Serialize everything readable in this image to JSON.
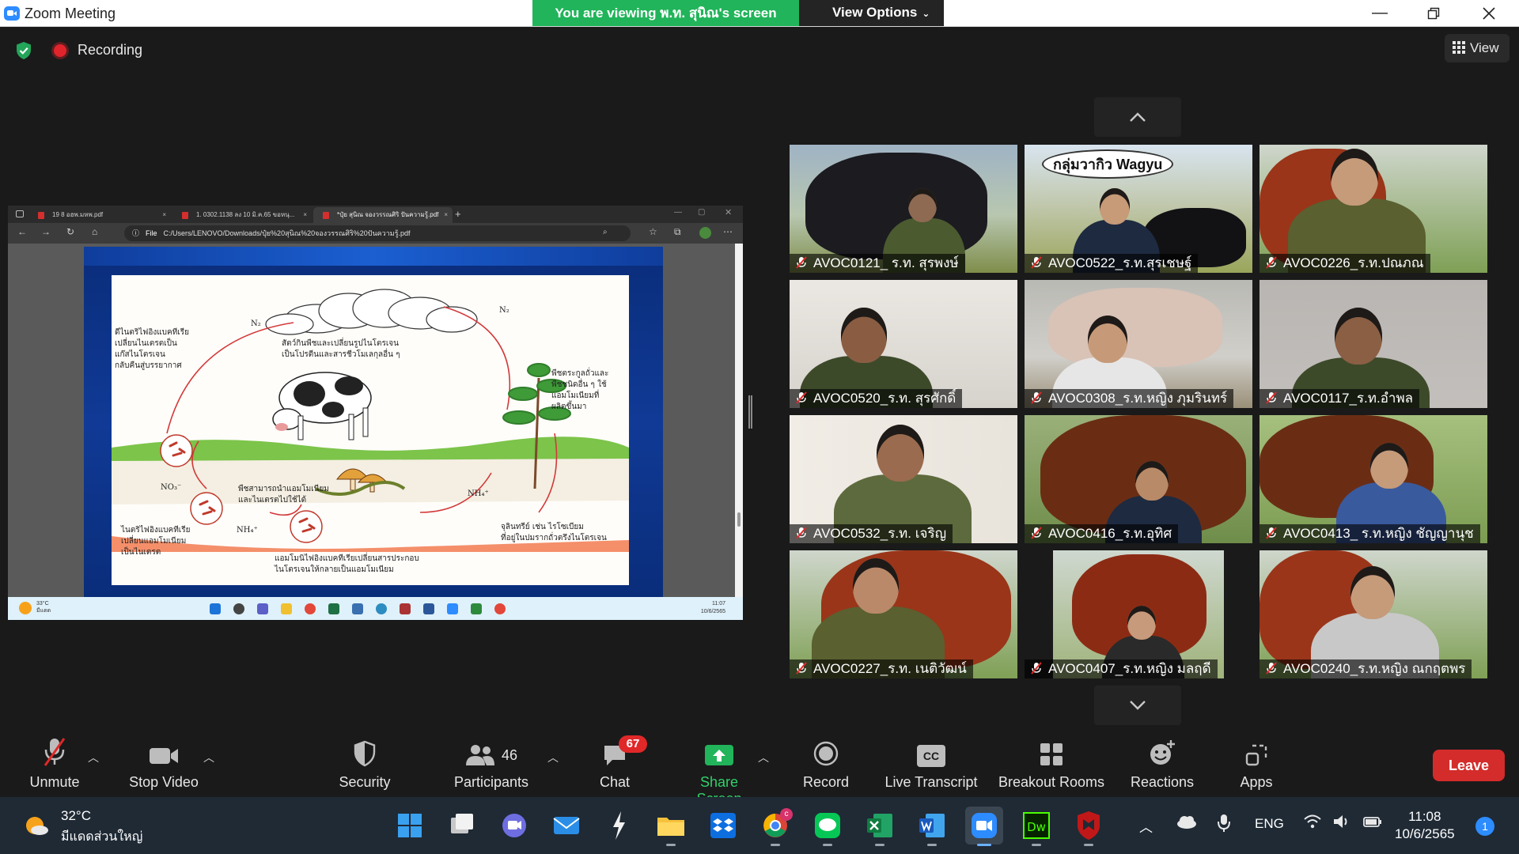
{
  "window": {
    "title": "Zoom Meeting",
    "share_banner": "You are viewing พ.ท. สุนิณ's screen",
    "view_options": "View Options"
  },
  "meeting": {
    "recording_label": "Recording",
    "view_label": "View"
  },
  "shared_screen": {
    "tabs": [
      {
        "label": "19 8 อฮพ.มหพ.pdf"
      },
      {
        "label": "1. 0302.1138 ลง 10 มิ.ค.65 ขอหนุ..."
      },
      {
        "label": "*ปุ๋ย สุนิณ จองวรรณศิริ ปันความรู้.pdf"
      }
    ],
    "url_prefix": "File",
    "url": "C:/Users/LENOVO/Downloads/ปุ๋ย%20สุนิณ%20จองวรรณศิริ%20ปันความรู้.pdf",
    "slide_texts": {
      "n2_top": "N₂",
      "n2_left": "N₂",
      "left_top": "ดีไนตริไฟอิงแบคทีเรีย\nเปลี่ยนไนเตรตเป็น\nแก๊สไนโตรเจน\nกลับคืนสู่บรรยากาศ",
      "center_top": "สัตว์กินพืชและเปลี่ยนรูปไนโตรเจน\nเป็นโปรตีนและสารชีวโมเลกุลอื่น ๆ",
      "right_top": "พืชตระกูลถั่วและ\nพืชชนิดอื่น ๆ ใช้\nแอมโมเนียมที่\nผลิตขึ้นมา",
      "no3": "NO₃⁻",
      "plant_use": "พืชสามารถนำแอมโมเนียม\nและไนเตรตไปใช้ได้",
      "nh4_right": "NH₄⁺",
      "left_bottom": "ไนตริไฟอิงแบคทีเรีย\nเปลี่ยนแอมโมเนียม\nเป็นไนเตรต",
      "nh4_mid": "NH₄⁺",
      "bottom_center": "แอมโมนิไฟอิงแบคทีเรียเปลี่ยนสารประกอบ\nไนโตรเจนให้กลายเป็นแอมโมเนียม",
      "right_bottom": "จุลินทรีย์ เช่น ไรโซเบียม\nที่อยู่ในปมรากถั่วตรึงไนโตรเจน"
    },
    "mini_taskbar": {
      "temp": "33°C",
      "cond": "มีแดด",
      "time": "11:07",
      "date": "10/6/2565"
    }
  },
  "participants": [
    {
      "name": "AVOC0121_ ร.ท. สุรพงษ์"
    },
    {
      "name": "AVOC0522_ร.ท.สุรเชษฐ์"
    },
    {
      "name": "AVOC0226_ร.ท.ปณภณ"
    },
    {
      "name": "AVOC0520_ร.ท. สุรศักดิ์"
    },
    {
      "name": "AVOC0308_ร.ท.หญิง ภุมรินทร์"
    },
    {
      "name": "AVOC0117_ร.ท.อำพล"
    },
    {
      "name": "AVOC0532_ร.ท. เจริญ"
    },
    {
      "name": "AVOC0416_ร.ท.อุทิศ"
    },
    {
      "name": "AVOC0413_ ร.ท.หญิง ชัญญานุช"
    },
    {
      "name": "AVOC0227_ร.ท. เนติวัฒน์"
    },
    {
      "name": "AVOC0407_ร.ท.หญิง มลฤดี"
    },
    {
      "name": "AVOC0240_ร.ท.หญิง ณกฤตพร"
    }
  ],
  "tile_caption": "กลุ่มวากิว Wagyu",
  "toolbar": {
    "unmute": "Unmute",
    "stop_video": "Stop Video",
    "security": "Security",
    "participants": "Participants",
    "participants_count": "46",
    "chat": "Chat",
    "chat_badge": "67",
    "share_screen": "Share Screen",
    "record": "Record",
    "live_transcript": "Live Transcript",
    "live_transcript_icon": "CC",
    "breakout_rooms": "Breakout Rooms",
    "reactions": "Reactions",
    "apps": "Apps",
    "leave": "Leave"
  },
  "taskbar": {
    "temp": "32°C",
    "condition": "มีแดดส่วนใหญ่",
    "language": "ENG",
    "time": "11:08",
    "date": "10/6/2565",
    "notifications": "1",
    "chrome_badge": "c"
  },
  "colors": {
    "accent": "#2d8cff",
    "share_green": "#21b45a",
    "leave_red": "#d42b2b",
    "recording_red": "#e0242c"
  }
}
